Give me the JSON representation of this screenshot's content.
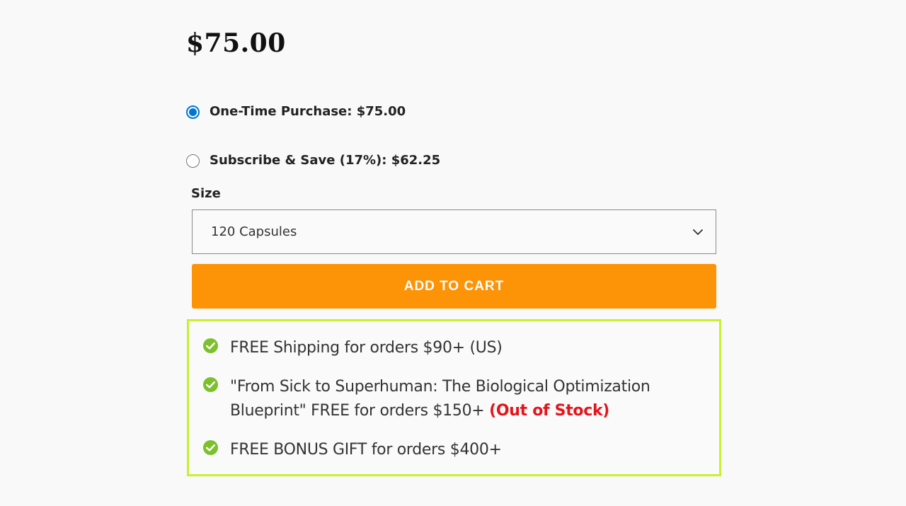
{
  "product": {
    "price": "$75.00"
  },
  "purchase_options": [
    {
      "label": "One-Time Purchase: $75.00",
      "selected": true
    },
    {
      "label": "Subscribe & Save (17%): $62.25",
      "selected": false
    }
  ],
  "size": {
    "label": "Size",
    "selected": "120 Capsules"
  },
  "cart": {
    "button_label": "ADD TO CART"
  },
  "perks": {
    "items": [
      {
        "text": "FREE Shipping for orders $90+ (US)"
      },
      {
        "text": "\"From Sick to Superhuman: The Biological Optimization Blueprint\" FREE for orders $150+",
        "status": "(Out of Stock)"
      },
      {
        "text": "FREE BONUS GIFT for orders $400+"
      }
    ]
  },
  "colors": {
    "accent_button": "#fd9306",
    "radio_selected": "#0075d4",
    "check_icon": "#7cc02c",
    "perks_border": "#c9f02f",
    "out_of_stock": "#e4141a"
  }
}
